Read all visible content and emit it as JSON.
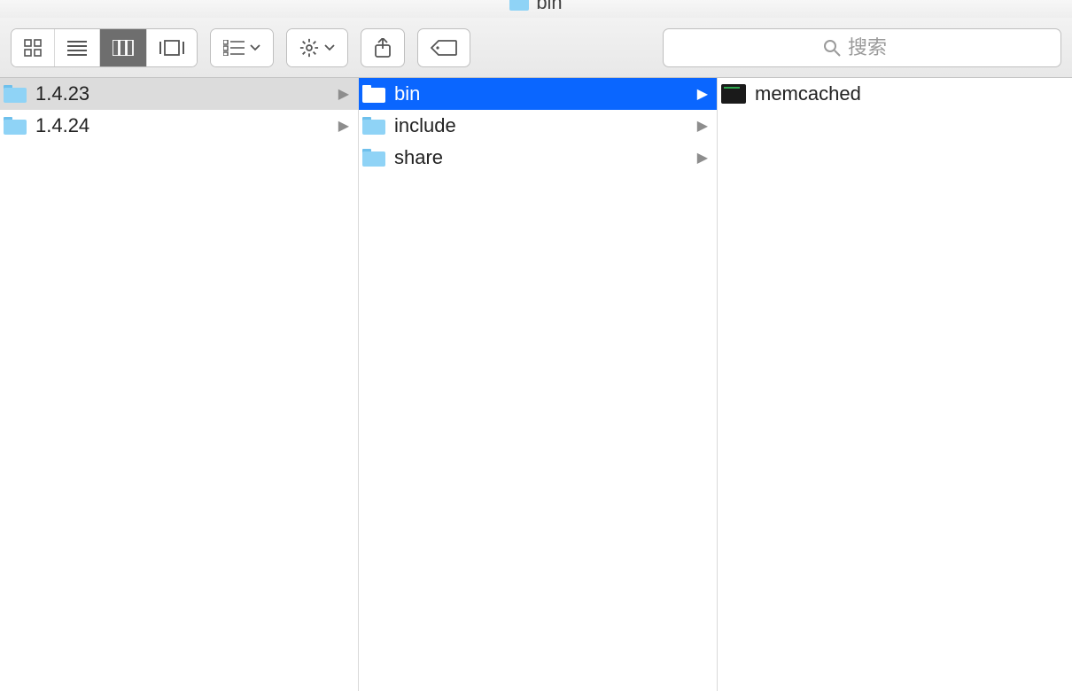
{
  "window": {
    "title": "bin"
  },
  "toolbar": {
    "search_placeholder": "搜索"
  },
  "columns": [
    {
      "items": [
        {
          "name": "1.4.23",
          "type": "folder",
          "has_children": true,
          "state": "dim-selected"
        },
        {
          "name": "1.4.24",
          "type": "folder",
          "has_children": true,
          "state": ""
        }
      ]
    },
    {
      "items": [
        {
          "name": "bin",
          "type": "folder",
          "has_children": true,
          "state": "selected"
        },
        {
          "name": "include",
          "type": "folder",
          "has_children": true,
          "state": ""
        },
        {
          "name": "share",
          "type": "folder",
          "has_children": true,
          "state": ""
        }
      ]
    },
    {
      "items": [
        {
          "name": "memcached",
          "type": "exec",
          "has_children": false,
          "state": ""
        }
      ]
    }
  ]
}
